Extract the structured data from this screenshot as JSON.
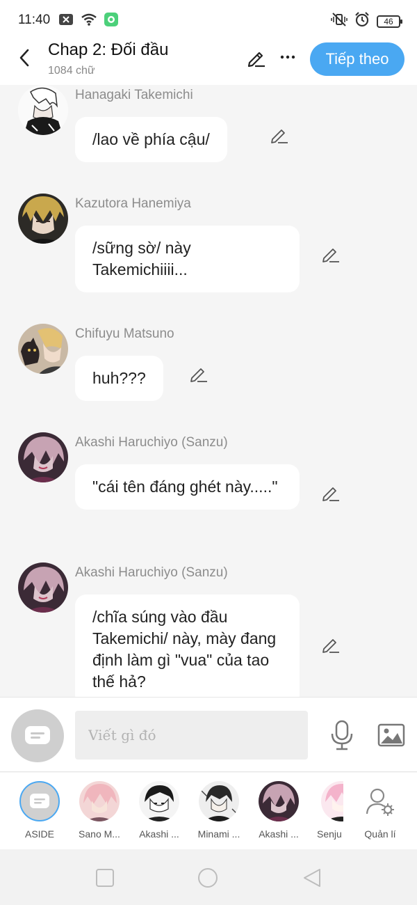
{
  "status": {
    "time": "11:40",
    "battery": "46"
  },
  "header": {
    "title": "Chap 2: Đối đầu",
    "word_count": "1084 chữ",
    "next_label": "Tiếp theo"
  },
  "messages": [
    {
      "sender": "Hanagaki Takemichi",
      "text": "/lao về phía cậu/",
      "avatar_icon": "takemichi-avatar"
    },
    {
      "sender": "Kazutora Hanemiya",
      "text": "/sững sờ/ này Takemichiiii...",
      "avatar_icon": "kazutora-avatar"
    },
    {
      "sender": "Chifuyu Matsuno",
      "text": "huh???",
      "avatar_icon": "chifuyu-avatar"
    },
    {
      "sender": "Akashi Haruchiyo (Sanzu)",
      "text": "\"cái tên đáng ghét này.....\"",
      "avatar_icon": "sanzu-avatar"
    },
    {
      "sender": "Akashi Haruchiyo (Sanzu)",
      "text": "/chĩa súng vào đầu Takemichi/ này, mày đang định làm gì \"vua\" của tao thế hả?",
      "avatar_icon": "sanzu-avatar"
    }
  ],
  "composer": {
    "placeholder": "Viết gì đó"
  },
  "characters": [
    {
      "label": "ASIDE"
    },
    {
      "label": "Sano M..."
    },
    {
      "label": "Akashi ..."
    },
    {
      "label": "Minami ..."
    },
    {
      "label": "Akashi ..."
    },
    {
      "label": "Senju"
    },
    {
      "label": "Quản lí"
    }
  ],
  "colors": {
    "accent": "#4aa8f2",
    "background": "#f5f5f5",
    "sender_text": "#8c8c8c"
  }
}
